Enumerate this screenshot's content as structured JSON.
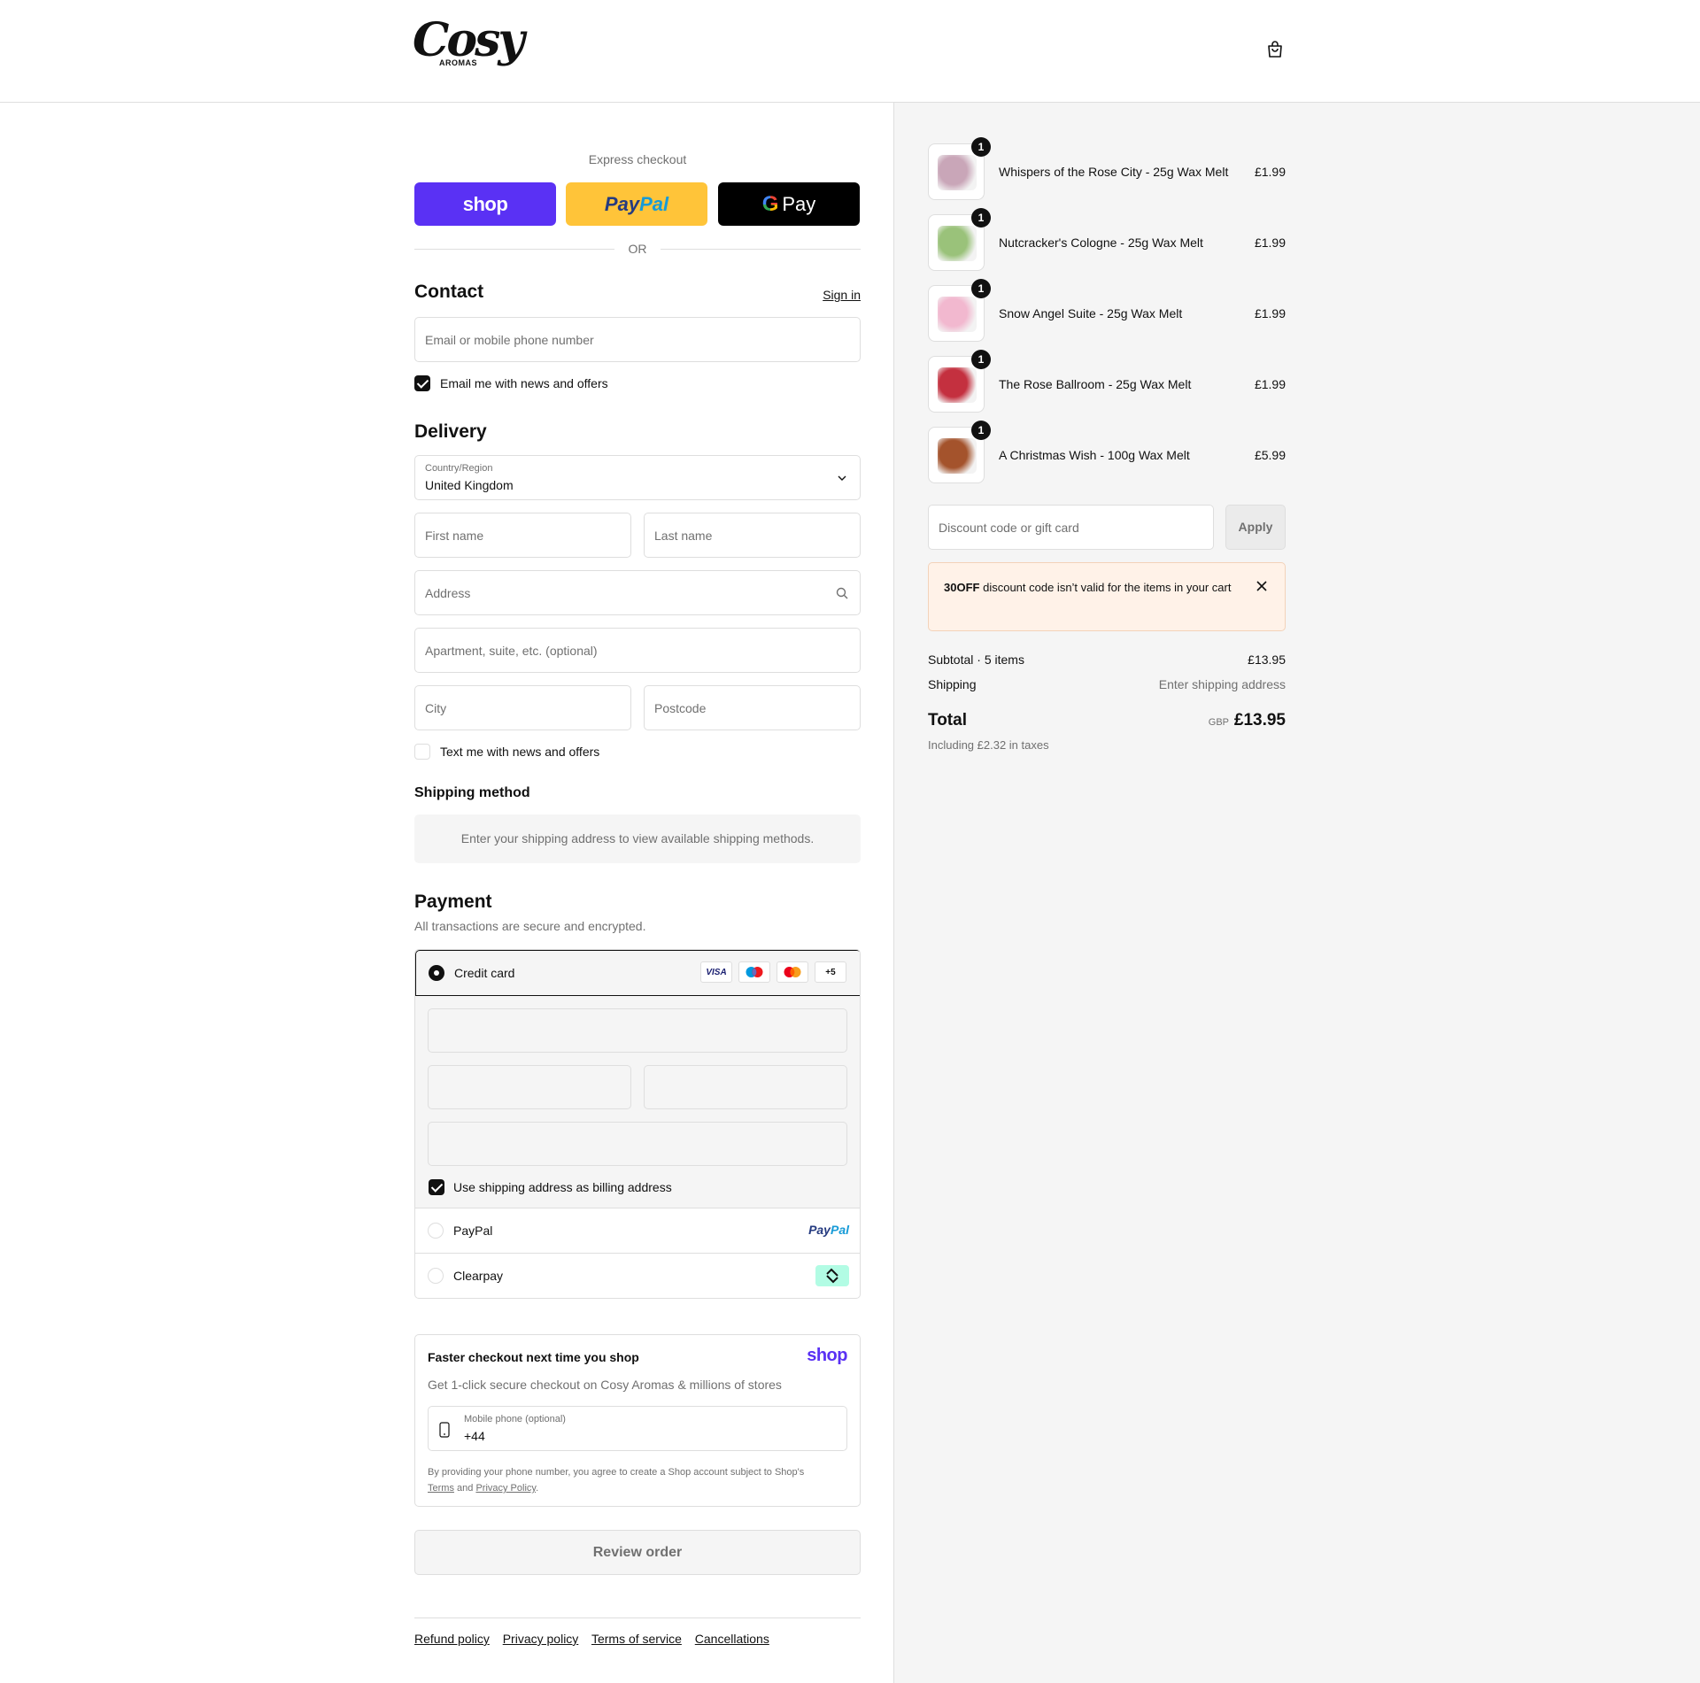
{
  "brand": {
    "logo_script": "Cosy",
    "logo_sub": "AROMAS"
  },
  "express": {
    "title": "Express checkout",
    "shop_label": "shop",
    "paypal_pay": "Pay",
    "paypal_pal": "Pal",
    "gpay_g": "G",
    "gpay_label": "Pay",
    "or": "OR"
  },
  "contact": {
    "heading": "Contact",
    "sign_in": "Sign in",
    "email_placeholder": "Email or mobile phone number",
    "news_label": "Email me with news and offers",
    "news_checked": true
  },
  "delivery": {
    "heading": "Delivery",
    "country_label": "Country/Region",
    "country_value": "United Kingdom",
    "first_name": "First name",
    "last_name": "Last name",
    "address": "Address",
    "apartment": "Apartment, suite, etc. (optional)",
    "city": "City",
    "postcode": "Postcode",
    "text_label": "Text me with news and offers",
    "text_checked": false
  },
  "shipping": {
    "heading": "Shipping method",
    "message": "Enter your shipping address to view available shipping methods."
  },
  "payment": {
    "heading": "Payment",
    "subtitle": "All transactions are secure and encrypted.",
    "credit_card": "Credit card",
    "cards": [
      "VISA",
      "maestro",
      "mastercard",
      "+5"
    ],
    "billing_label": "Use shipping address as billing address",
    "billing_checked": true,
    "paypal": "PayPal",
    "paypal_logo_pay": "Pay",
    "paypal_logo_pal": "Pal",
    "clearpay": "Clearpay"
  },
  "shop_pay": {
    "title": "Faster checkout next time you shop",
    "wordmark": "shop",
    "subtitle": "Get 1-click secure checkout on Cosy Aromas & millions of stores",
    "phone_label": "Mobile phone (optional)",
    "phone_value": "+44",
    "legal_prefix": "By providing your phone number, you agree to create a Shop account subject to Shop's",
    "terms": "Terms",
    "and": "and",
    "privacy": "Privacy Policy",
    "period": "."
  },
  "review_button": "Review order",
  "footer_links": [
    "Refund policy",
    "Privacy policy",
    "Terms of service",
    "Cancellations"
  ],
  "cart": {
    "items": [
      {
        "name": "Whispers of the Rose City - 25g Wax Melt",
        "price": "£1.99",
        "qty": "1",
        "color": "#c9a6b8"
      },
      {
        "name": "Nutcracker's Cologne - 25g Wax Melt",
        "price": "£1.99",
        "qty": "1",
        "color": "#9ac27a"
      },
      {
        "name": "Snow Angel Suite - 25g Wax Melt",
        "price": "£1.99",
        "qty": "1",
        "color": "#f2b8cf"
      },
      {
        "name": "The Rose Ballroom - 25g Wax Melt",
        "price": "£1.99",
        "qty": "1",
        "color": "#c4303f"
      },
      {
        "name": "A Christmas Wish - 100g Wax Melt",
        "price": "£5.99",
        "qty": "1",
        "color": "#a4532c"
      }
    ],
    "discount_placeholder": "Discount code or gift card",
    "apply": "Apply",
    "notice_code": "30OFF",
    "notice_text": "discount code isn’t valid for the items in your cart",
    "subtotal_label": "Subtotal · 5 items",
    "subtotal_value": "£13.95",
    "shipping_label": "Shipping",
    "shipping_value": "Enter shipping address",
    "total_label": "Total",
    "currency": "GBP",
    "total_value": "£13.95",
    "tax_note": "Including £2.32 in taxes"
  }
}
